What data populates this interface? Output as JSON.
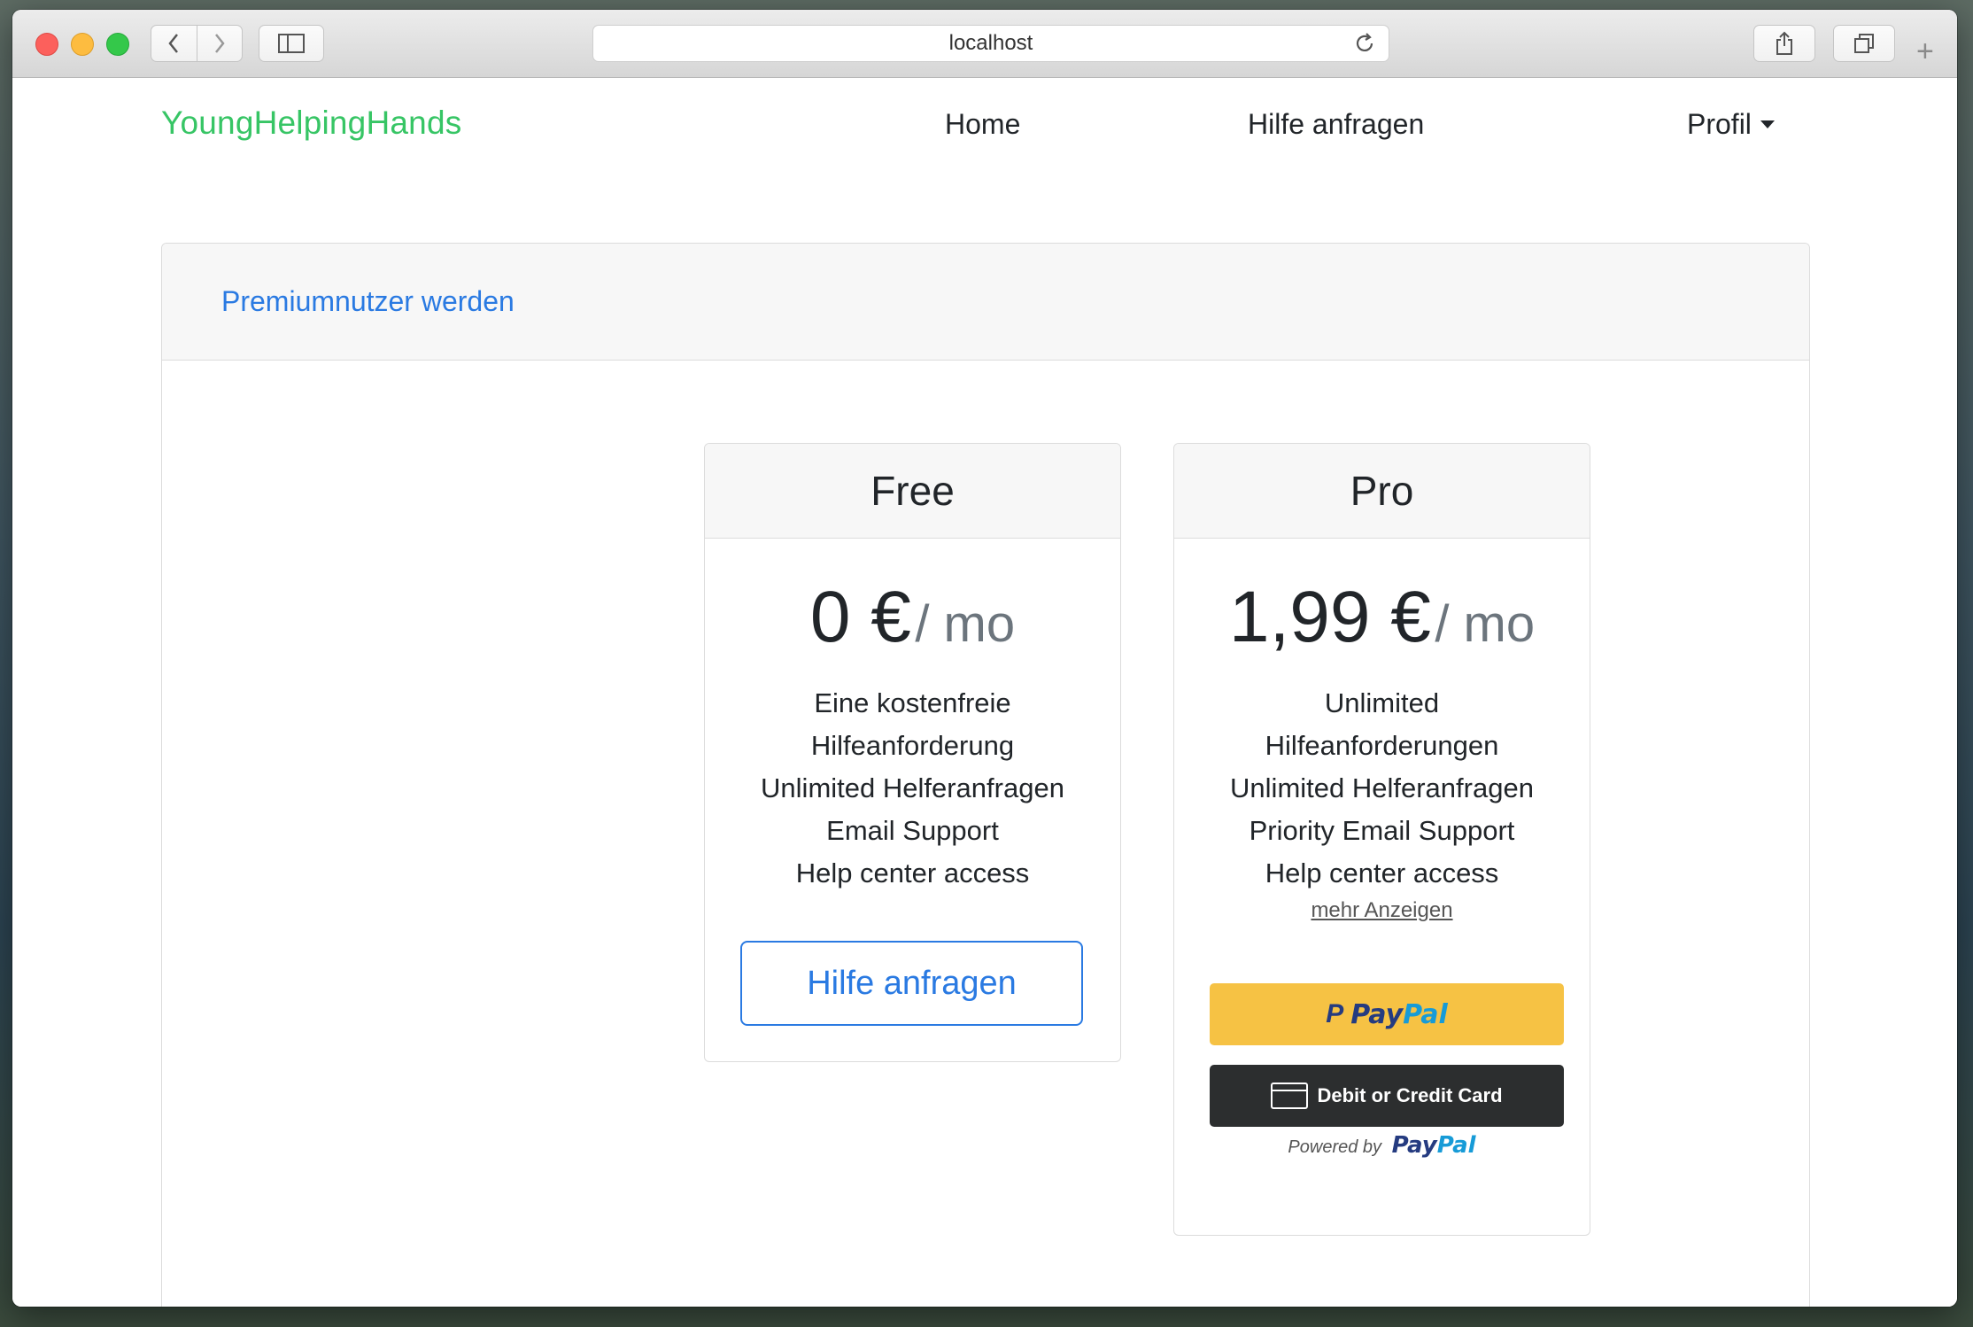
{
  "browser": {
    "url": "localhost"
  },
  "navbar": {
    "brand": "YoungHelpingHands",
    "links": [
      "Home",
      "Hilfe anfragen"
    ],
    "profile": "Profil"
  },
  "card": {
    "title": "Premiumnutzer werden"
  },
  "plans": [
    {
      "name": "Free",
      "price": "0 €",
      "period": "/ mo",
      "features": [
        "Eine kostenfreie",
        "Hilfeanforderung",
        "Unlimited Helferanfragen",
        "Email Support",
        "Help center access"
      ],
      "button": "Hilfe anfragen"
    },
    {
      "name": "Pro",
      "price": "1,99 €",
      "period": "/ mo",
      "features": [
        "Unlimited",
        "Hilfeanforderungen",
        "Unlimited Helferanfragen",
        "Priority Email Support",
        "Help center access"
      ],
      "more": "mehr Anzeigen",
      "paypal_label_a": "Pay",
      "paypal_label_b": "Pal",
      "card_button": "Debit or Credit Card",
      "powered_by": "Powered by"
    }
  ],
  "colors": {
    "brand": "#37c565",
    "link": "#2a7ae2",
    "paypal_yellow": "#f6c244",
    "paypal_dark": "#2c2e2f"
  }
}
